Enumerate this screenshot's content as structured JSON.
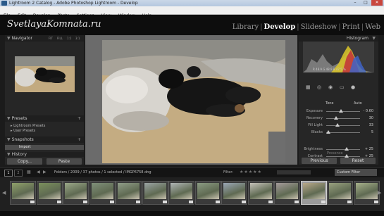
{
  "window": {
    "title": "Lightroom 2 Catalog - Adobe Photoshop Lightroom - Develop",
    "min": "–",
    "max": "□",
    "close": "✕"
  },
  "menu": [
    "File",
    "Edit",
    "Develop",
    "Photo",
    "Settings",
    "View",
    "Window",
    "Help"
  ],
  "identity_plate": "SvetlayaKomnata.ru",
  "modules": [
    {
      "label": "Library",
      "active": false
    },
    {
      "label": "Develop",
      "active": true
    },
    {
      "label": "Slideshow",
      "active": false
    },
    {
      "label": "Print",
      "active": false
    },
    {
      "label": "Web",
      "active": false
    }
  ],
  "left": {
    "navigator": {
      "title": "Navigator",
      "zoom": [
        "FIT",
        "FILL",
        "1:1",
        "3:1"
      ]
    },
    "presets": {
      "title": "Presets",
      "items": [
        "Lightroom Presets",
        "User Presets"
      ]
    },
    "snapshots": {
      "title": "Snapshots",
      "items": [
        "Import"
      ]
    },
    "history": {
      "title": "History"
    },
    "copy": "Copy...",
    "paste": "Paste"
  },
  "right": {
    "histogram": {
      "title": "Histogram",
      "readout": "R 48.9   G 48.9   B 47.5 %"
    },
    "basic": {
      "tone_label": "Tone",
      "auto_label": "Auto",
      "sliders": [
        {
          "label": "Exposure",
          "value": "- 0.60",
          "pos": 0.44
        },
        {
          "label": "Recovery",
          "value": "30",
          "pos": 0.3
        },
        {
          "label": "Fill Light",
          "value": "33",
          "pos": 0.33
        },
        {
          "label": "Blacks",
          "value": "5",
          "pos": 0.06
        },
        {
          "label": "Brightness",
          "value": "+ 25",
          "pos": 0.6
        },
        {
          "label": "Contrast",
          "value": "+ 25",
          "pos": 0.6
        }
      ],
      "presence_label": "Presence"
    },
    "previous": "Previous",
    "reset": "Reset"
  },
  "toolbar": {
    "page1": "1",
    "page2": "2",
    "breadcrumb": "Folders / 2009 / 37 photos / 1 selected / IMGP6758.dng",
    "filter_label": "Filter:",
    "custom_filter": "Custom Filter"
  },
  "filmstrip": {
    "thumb_colors": [
      "#8fa06a",
      "#7a8f5c",
      "#9aa788",
      "#7f8f79",
      "#8f9c88",
      "#9aa3a3",
      "#b0b5b5",
      "#8a9a82",
      "#9aa6b5",
      "#c4c1b8",
      "#a49a9a",
      "#b9a98a",
      "#98a07e",
      "#a6b08a"
    ],
    "selected_index": 11
  }
}
